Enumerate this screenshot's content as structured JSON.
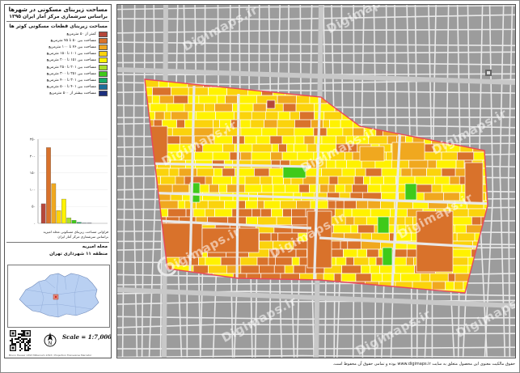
{
  "title": {
    "line1": "مساحت زیربنای مسکونی در شهرها",
    "line2": "براساس سرشماری مرکز آمار ایران ۱۳۹۵"
  },
  "legend": {
    "title": "مساحت زیربنای قطعات مسکونی کوثر ها",
    "items": [
      {
        "label": "کمتر از ۵۰ مترمربع",
        "color": "#b5473a"
      },
      {
        "label": "مساحت بین ۵۰ تا ۷۵ مترمربع",
        "color": "#d9722b"
      },
      {
        "label": "مساحت بین ۷۶ تا ۱۰۰ مترمربع",
        "color": "#f0a81f"
      },
      {
        "label": "مساحت بین ۱۰۱ تا ۱۵۰ مترمربع",
        "color": "#fbd30c"
      },
      {
        "label": "مساحت بین ۱۵۱ تا ۲۰۰ مترمربع",
        "color": "#fff200"
      },
      {
        "label": "مساحت بین ۲۰۱ تا ۲۵۰ مترمربع",
        "color": "#a8e02a"
      },
      {
        "label": "مساحت بین ۲۵۱ تا ۳۰۰ مترمربع",
        "color": "#3fca1a"
      },
      {
        "label": "مساحت بین ۳۰۱ تا ۴۰۰ مترمربع",
        "color": "#16a86a"
      },
      {
        "label": "مساحت بین ۴۰۱ تا ۵۰۰ مترمربع",
        "color": "#1b6f9c"
      },
      {
        "label": "مساحت بیشتر از ۵۰۰ مترمربع",
        "color": "#1c2f7e"
      }
    ]
  },
  "chart_data": {
    "type": "bar",
    "y_ticks": [
      "۲۵۰",
      "۲۰۰",
      "۱۵۰",
      "۱۰۰",
      "۵۰",
      "۰"
    ],
    "ylim": [
      0,
      250
    ],
    "values": [
      58,
      225,
      118,
      38,
      72,
      16,
      9,
      3,
      1,
      1
    ],
    "colors": [
      "#b5473a",
      "#d9722b",
      "#f0a81f",
      "#fbd30c",
      "#fff200",
      "#a8e02a",
      "#3fca1a",
      "#16a86a",
      "#1b6f9c",
      "#1c2f7e"
    ]
  },
  "histogram_caption": {
    "line1": "فراوانی مساحت زیربنای مسکونی محله امیریه",
    "line2": "براساس سرشماری مرکز آمار ایران"
  },
  "neighborhood": {
    "name": "محله امیریه",
    "district": "منطقه ۱۱ شهرداری تهران"
  },
  "scale": {
    "text": "Scale = 1:7,000"
  },
  "north_arrow": {
    "letter": "N",
    "icon": "north-arrow-icon"
  },
  "tiny_note": "Bruno Hauser 1393 Millenium 1393 / Projection Transverse Mercator",
  "footer": {
    "text": "حقوق مالکیت معنوی این محصول متعلق به سایت www.digimaps.ir بوده و تمامی حقوق آن محفوظ است."
  },
  "watermark": {
    "text": "Digimaps.ir"
  },
  "map_colors": {
    "background_gray": "#9c9c9c",
    "street_white": "#e9e9e9",
    "boundary_red": "#e8495c",
    "main_road": "#c8c8c8",
    "inset_city": "#b9d0f2",
    "inset_district": "#e08a7a"
  }
}
